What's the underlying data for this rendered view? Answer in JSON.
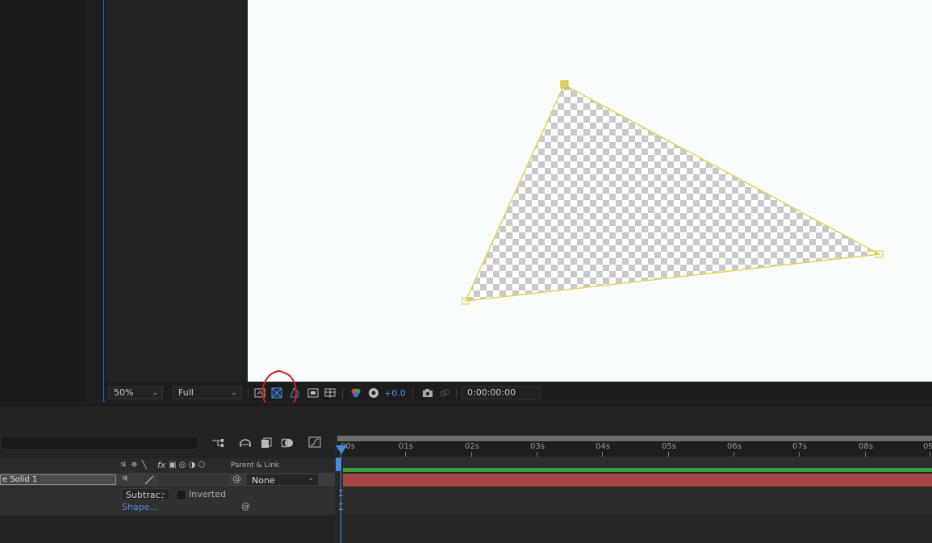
{
  "viewer": {
    "zoom_value": "50%",
    "resolution_value": "Full",
    "exposure_value": "+0.0",
    "timecode": "0:00:00:00"
  },
  "timeline": {
    "columns_label": "Parent & Link",
    "layer": {
      "name": "e Solid 1",
      "parent_value": "None"
    },
    "mask": {
      "mode_value": "Subtract",
      "inverted_label": "Inverted",
      "shape_label": "Shape..."
    },
    "ruler_labels": [
      "00s",
      "01s",
      "02s",
      "03s",
      "04s",
      "05s",
      "06s",
      "07s",
      "08s",
      "09"
    ]
  },
  "colors": {
    "accent": "#3f8fe0",
    "mask_path": "#e6d35a",
    "layer_bar": "#a74646",
    "work_bar": "#3aa23a",
    "annotation_circle": "#d01f1f"
  },
  "icons": [
    "chevron-down-icon",
    "region-of-interest-icon",
    "toggle-transparency-grid-icon",
    "toggle-mask-visibility-icon",
    "title-action-safe-icon",
    "snapshot-icon",
    "color-channels-icon",
    "reset-exposure-icon",
    "camera-icon",
    "show-snapshot-icon",
    "comp-flowchart-icon",
    "shy-icon",
    "frame-blending-icon",
    "motion-blur-icon",
    "graph-editor-icon",
    "spiral-pickwhip-icon"
  ]
}
